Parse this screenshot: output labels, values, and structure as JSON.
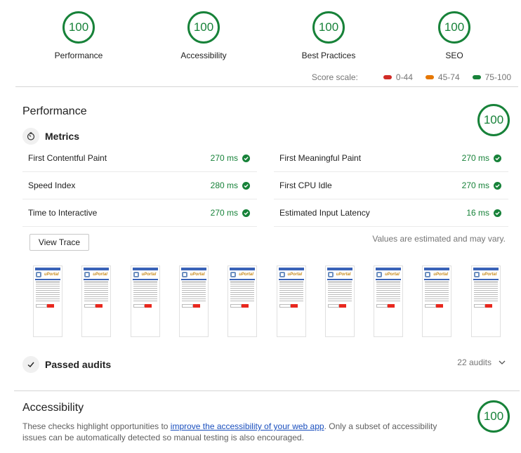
{
  "summary": {
    "gauges": [
      {
        "label": "Performance",
        "score": "100"
      },
      {
        "label": "Accessibility",
        "score": "100"
      },
      {
        "label": "Best Practices",
        "score": "100"
      },
      {
        "label": "SEO",
        "score": "100"
      }
    ],
    "score_scale": {
      "label": "Score scale:",
      "ranges": [
        {
          "label": "0-44",
          "color": "#d12c27"
        },
        {
          "label": "45-74",
          "color": "#e67700"
        },
        {
          "label": "75-100",
          "color": "#178239"
        }
      ]
    }
  },
  "performance": {
    "title": "Performance",
    "score": "100",
    "metrics_title": "Metrics",
    "metrics_left": [
      {
        "label": "First Contentful Paint",
        "value": "270 ms"
      },
      {
        "label": "Speed Index",
        "value": "280 ms"
      },
      {
        "label": "Time to Interactive",
        "value": "270 ms"
      }
    ],
    "metrics_right": [
      {
        "label": "First Meaningful Paint",
        "value": "270 ms"
      },
      {
        "label": "First CPU Idle",
        "value": "270 ms"
      },
      {
        "label": "Estimated Input Latency",
        "value": "16 ms"
      }
    ],
    "view_trace_label": "View Trace",
    "estimated_note": "Values are estimated and may vary.",
    "filmstrip": {
      "frame_count": 10,
      "logo_text": "uPortal"
    },
    "passed_audits": {
      "label": "Passed audits",
      "count": "22 audits"
    }
  },
  "accessibility": {
    "title": "Accessibility",
    "score": "100",
    "desc_before": "These checks highlight opportunities to ",
    "desc_link": "improve the accessibility of your web app",
    "desc_after": ". Only a subset of accessibility issues can be automatically detected so manual testing is also encouraged."
  },
  "colors": {
    "pass": "#178239"
  }
}
